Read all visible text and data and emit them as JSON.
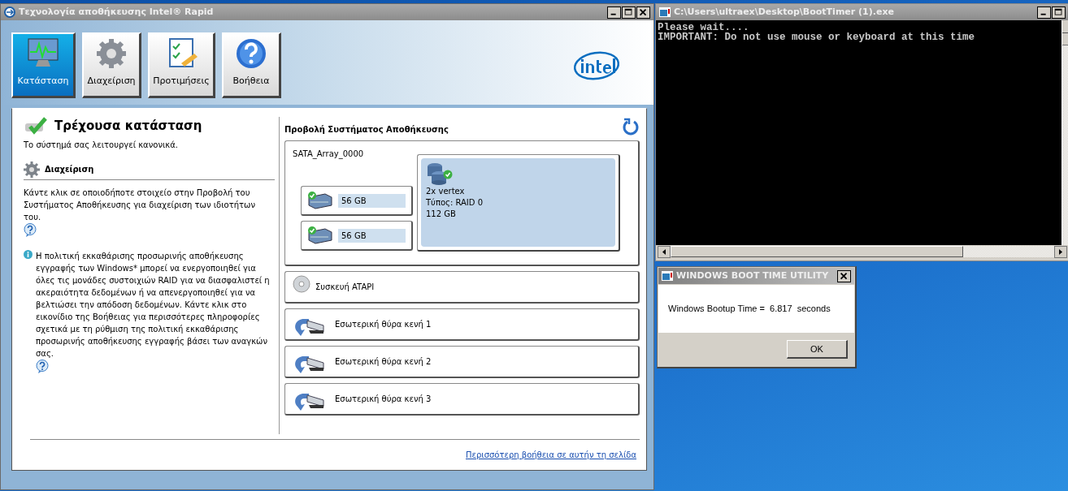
{
  "intel_window": {
    "title": "Τεχνολογία αποθήκευσης Intel® Rapid",
    "toolbar": [
      {
        "kind": "status",
        "label": "Κατάσταση",
        "selected": true
      },
      {
        "kind": "manage",
        "label": "Διαχείριση",
        "selected": false
      },
      {
        "kind": "prefs",
        "label": "Προτιμήσεις",
        "selected": false
      },
      {
        "kind": "help",
        "label": "Βοήθεια",
        "selected": false
      }
    ],
    "status": {
      "heading": "Τρέχουσα κατάσταση",
      "text": "Το σύστημά σας λειτουργεί κανονικά."
    },
    "management": {
      "heading": "Διαχείριση",
      "text": "Κάντε κλικ σε οποιοδήποτε στοιχείο στην Προβολή του Συστήματος Αποθήκευσης για διαχείριση των ιδιοτήτων του.",
      "info_text": "Η πολιτική εκκαθάρισης προσωρινής αποθήκευσης εγγραφής των Windows* μπορεί να ενεργοποιηθεί για όλες τις μονάδες συστοιχιών RAID για να διασφαλιστεί η ακεραιότητα δεδομένων ή να απενεργοποιηθεί για να βελτιώσει την απόδοση δεδομένων. Κάντε κλικ στο εικονίδιο της Βοήθειας για περισσότερες πληροφορίες σχετικά με τη ρύθμιση της πολιτική εκκαθάρισης προσωρινής αποθήκευσης εγγραφής βάσει των αναγκών σας."
    },
    "storage_view": {
      "heading": "Προβολή Συστήματος Αποθήκευσης",
      "array": {
        "name": "SATA_Array_0000",
        "disks": [
          {
            "size": "56 GB"
          },
          {
            "size": "56 GB"
          }
        ],
        "volume": {
          "name": "2x vertex",
          "type": "Τύπος: RAID 0",
          "size": "112 GB"
        }
      },
      "devices": [
        {
          "kind": "atapi",
          "label": "Συσκευή ATAPI"
        },
        {
          "kind": "port",
          "label": "Εσωτερική θύρα κενή 1"
        },
        {
          "kind": "port",
          "label": "Εσωτερική θύρα κενή 2"
        },
        {
          "kind": "port",
          "label": "Εσωτερική θύρα κενή 3"
        }
      ]
    },
    "help_link": "Περισσότερη βοήθεια σε αυτήν τη σελίδα"
  },
  "console_window": {
    "title": "C:\\Users\\ultraex\\Desktop\\BootTimer (1).exe",
    "lines": [
      "Please wait....",
      "IMPORTANT: Do not use mouse or keyboard at this time"
    ]
  },
  "dialog": {
    "title": "WINDOWS BOOT TIME UTILITY",
    "message": "Windows Bootup Time =  6.817  seconds",
    "button": "OK"
  }
}
